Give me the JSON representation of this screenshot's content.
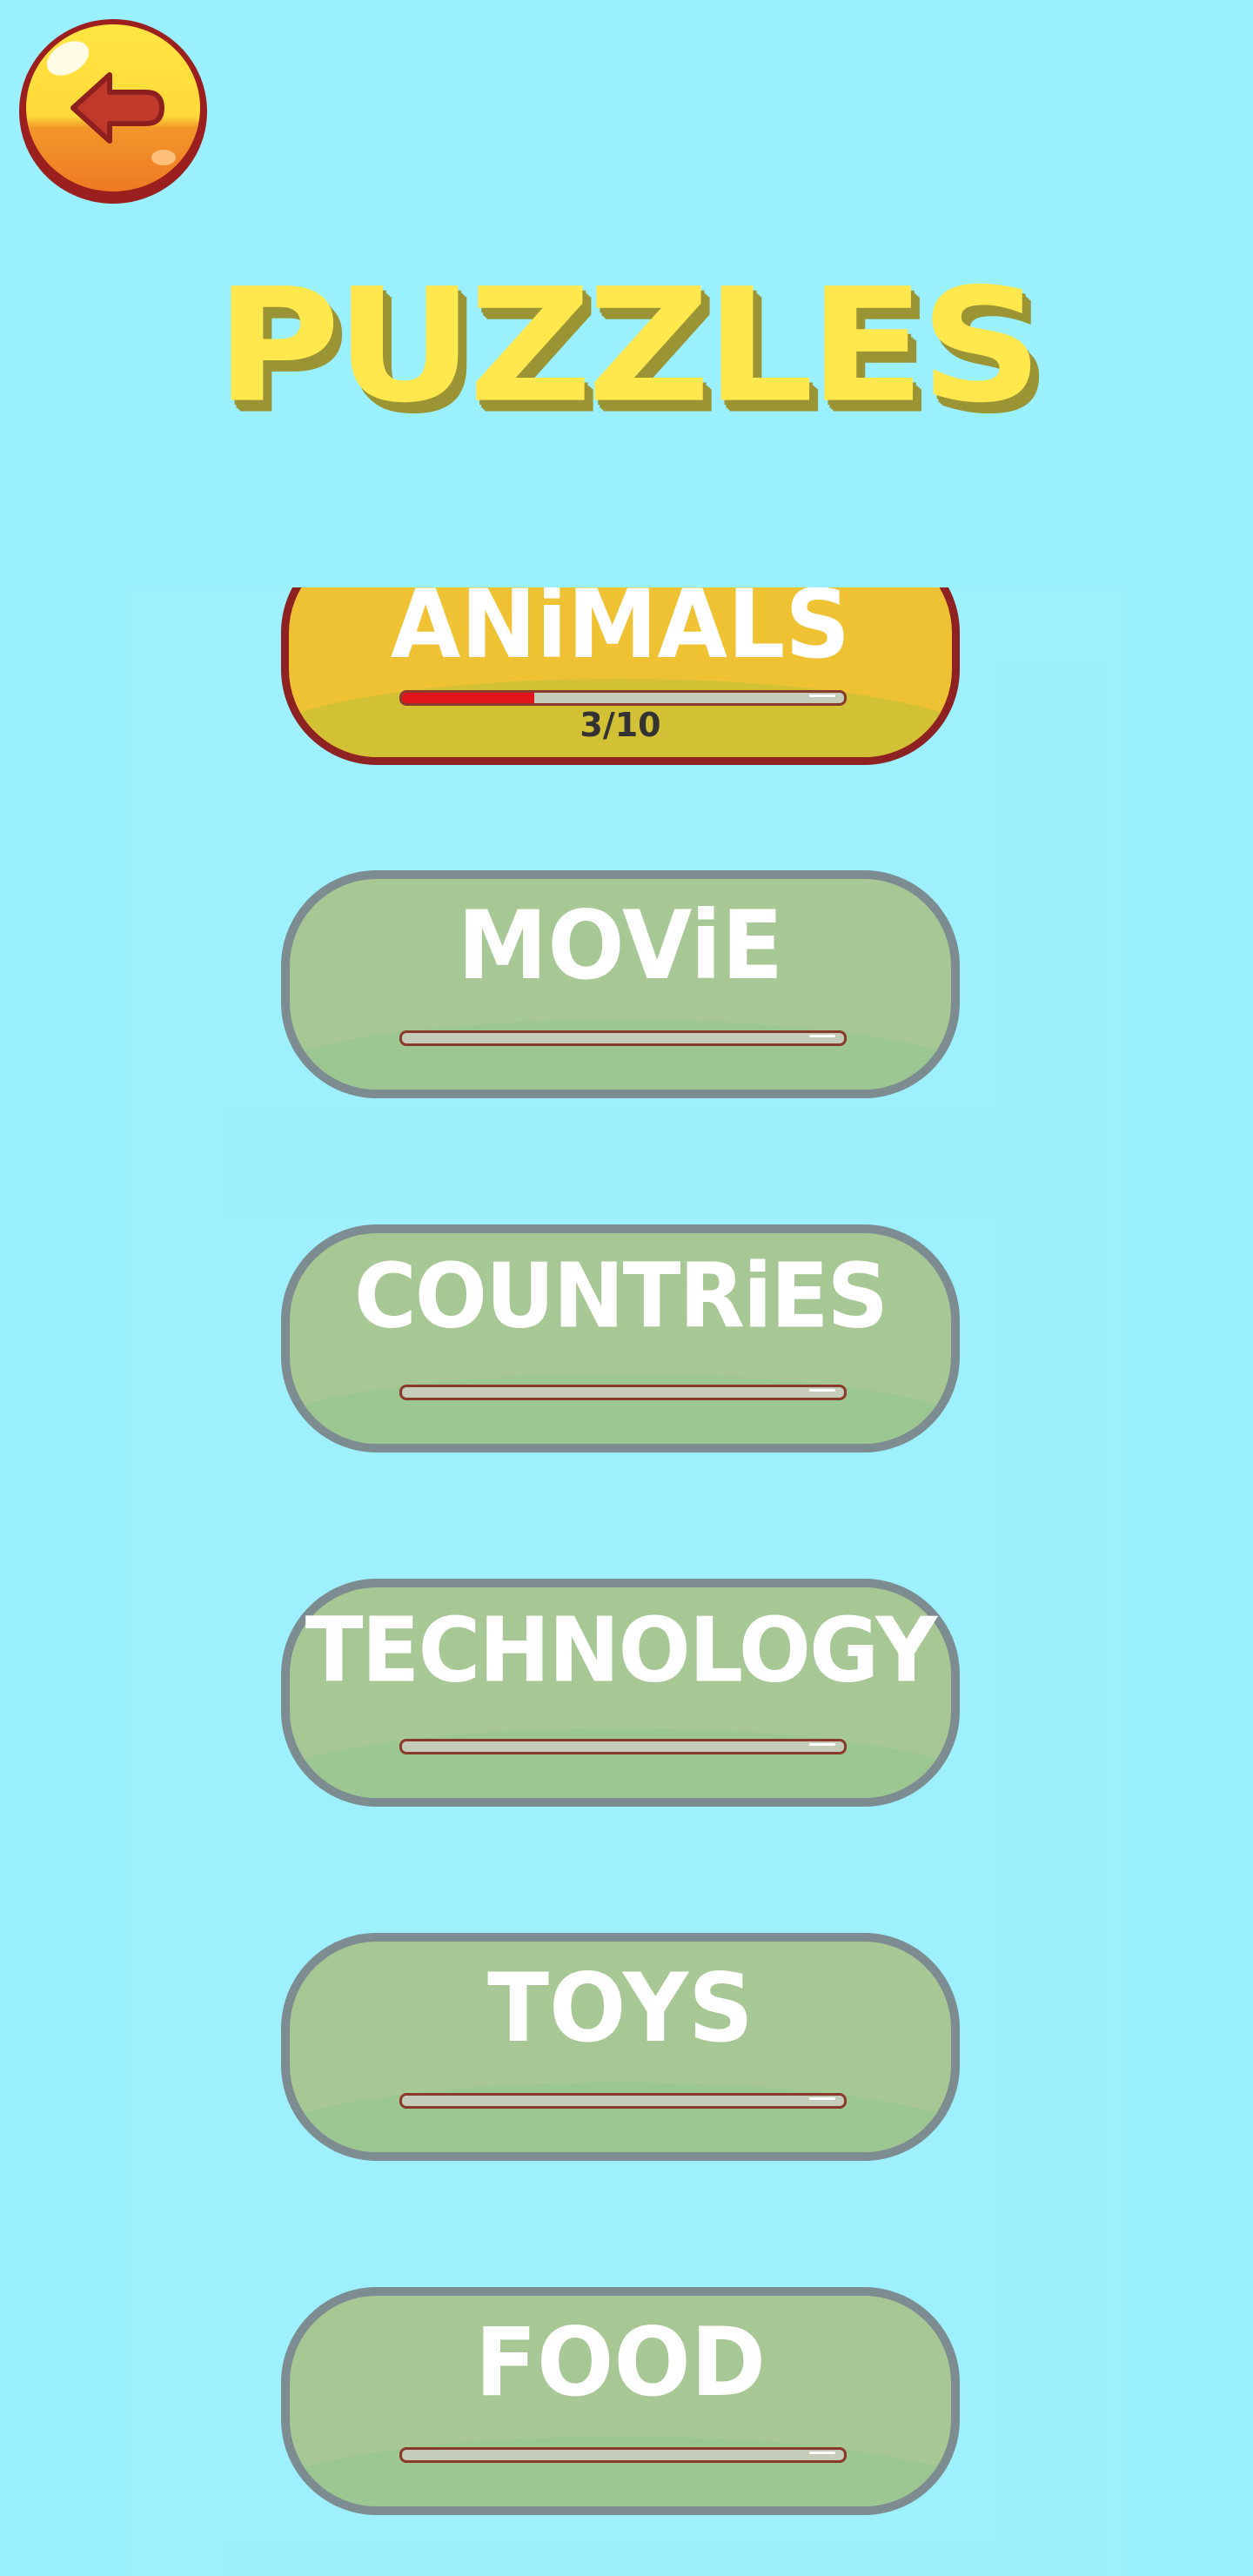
{
  "header": {
    "title": "PUZZLES",
    "back_icon": "arrow-left-icon"
  },
  "categories": [
    {
      "label": "ANiMALS",
      "progress_text": "3/10",
      "progress": 0.3,
      "state": "active"
    },
    {
      "label": "MOViE",
      "progress_text": "",
      "progress": 0,
      "state": "locked"
    },
    {
      "label": "COUNTRiES",
      "progress_text": "",
      "progress": 0,
      "state": "locked"
    },
    {
      "label": "TECHNOLOGY",
      "progress_text": "",
      "progress": 0,
      "state": "locked"
    },
    {
      "label": "TOYS",
      "progress_text": "",
      "progress": 0,
      "state": "locked"
    },
    {
      "label": "FOOD",
      "progress_text": "",
      "progress": 0,
      "state": "locked"
    }
  ],
  "colors": {
    "background": "#9af1fd",
    "title": "#ffe84d",
    "active_card": "#efc234",
    "locked_card": "#a7c795",
    "progress_fill": "#e0141a"
  }
}
